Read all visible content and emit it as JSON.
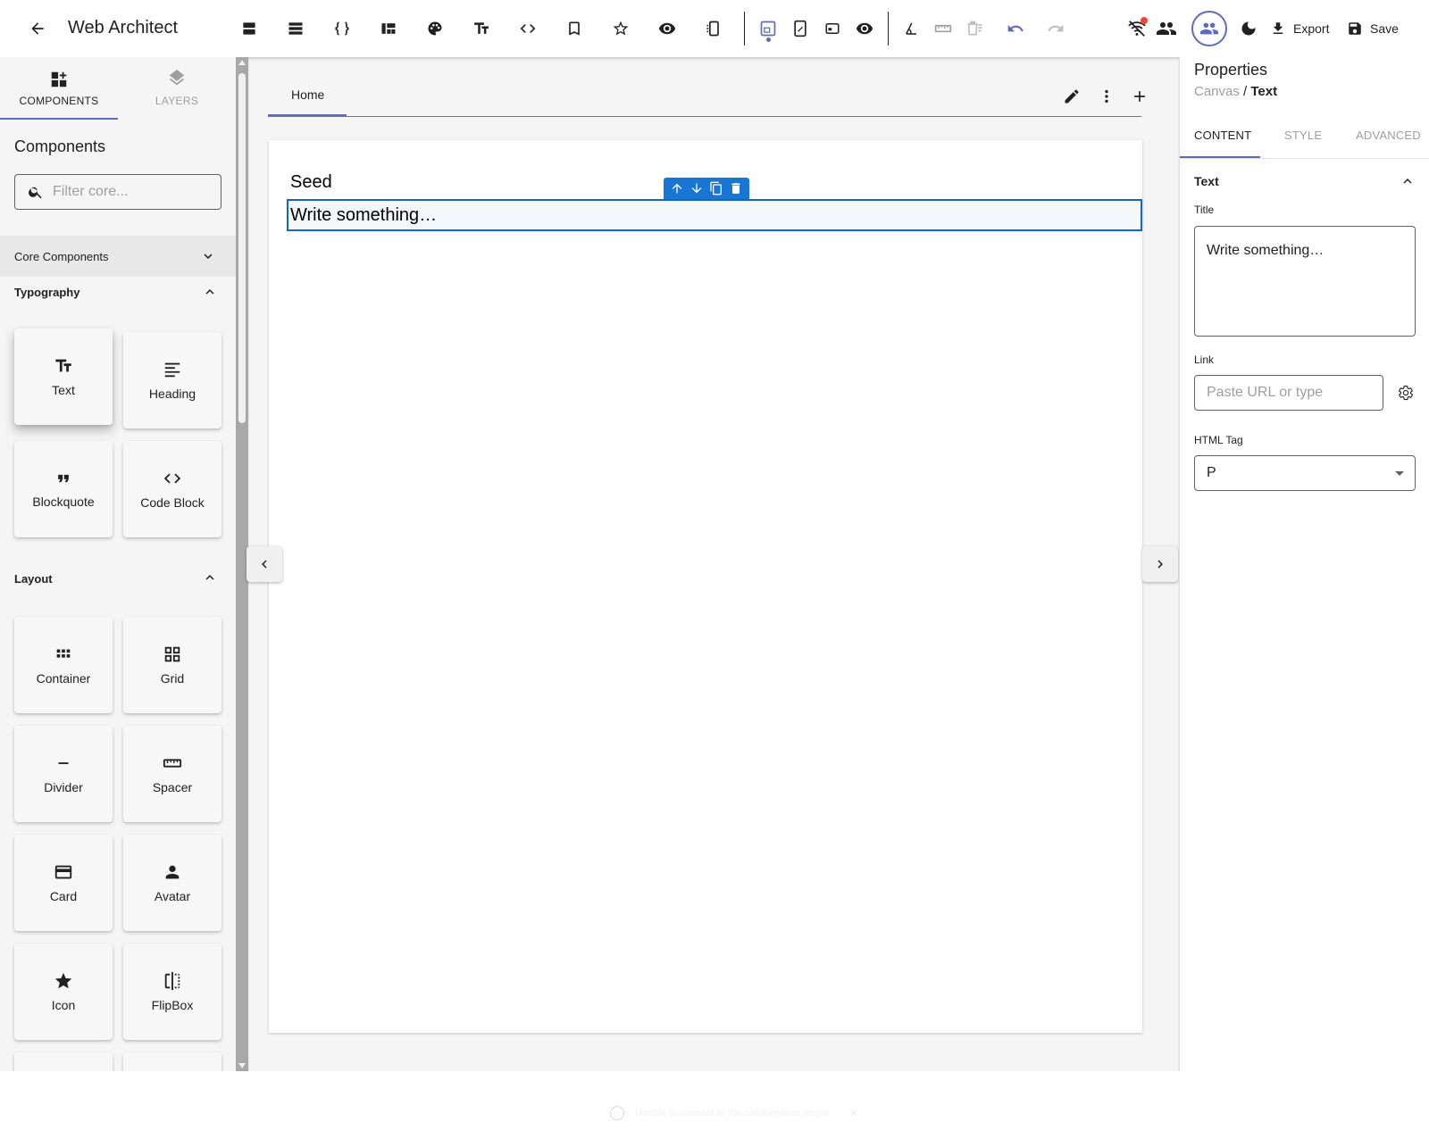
{
  "app": {
    "title": "Web Architect"
  },
  "toolbar": {
    "icons": [
      "view-agenda-icon",
      "view-list-icon",
      "data-object-icon",
      "view-quilt-icon",
      "palette-icon",
      "text-fields-icon",
      "code-icon",
      "bookmark-icon",
      "star-icon",
      "eye-icon",
      "devices-icon",
      "desktop-view-icon",
      "tablet-view-icon",
      "mobile-view-icon",
      "preview-icon",
      "angle-icon",
      "ruler-icon",
      "clear-all-icon",
      "undo-icon",
      "redo-icon"
    ],
    "export_label": "Export",
    "save_label": "Save",
    "accent": "#5c6bc0"
  },
  "left_panel": {
    "tabs": [
      {
        "label": "COMPONENTS",
        "active": true
      },
      {
        "label": "LAYERS",
        "active": false
      }
    ],
    "heading": "Components",
    "filter_placeholder": "Filter core...",
    "core_section": "Core Components",
    "sections": [
      {
        "title": "Typography",
        "items": [
          "Text",
          "Heading",
          "Blockquote",
          "Code Block"
        ]
      },
      {
        "title": "Layout",
        "items": [
          "Container",
          "Grid",
          "Divider",
          "Spacer",
          "Card",
          "Avatar",
          "Icon",
          "FlipBox"
        ]
      }
    ]
  },
  "canvas": {
    "page_tab": "Home",
    "seed_text": "Seed",
    "selected_text": "Write something…",
    "toast_text": "Unable to connect to the collaboration server"
  },
  "properties": {
    "title": "Properties",
    "breadcrumb": {
      "parent": "Canvas",
      "separator": "/",
      "current": "Text"
    },
    "tabs": [
      "CONTENT",
      "STYLE",
      "ADVANCED"
    ],
    "accordion_title": "Text",
    "title_label": "Title",
    "title_value": "Write something…",
    "link_label": "Link",
    "link_placeholder": "Paste URL or type",
    "html_tag_label": "HTML Tag",
    "html_tag_value": "P"
  }
}
